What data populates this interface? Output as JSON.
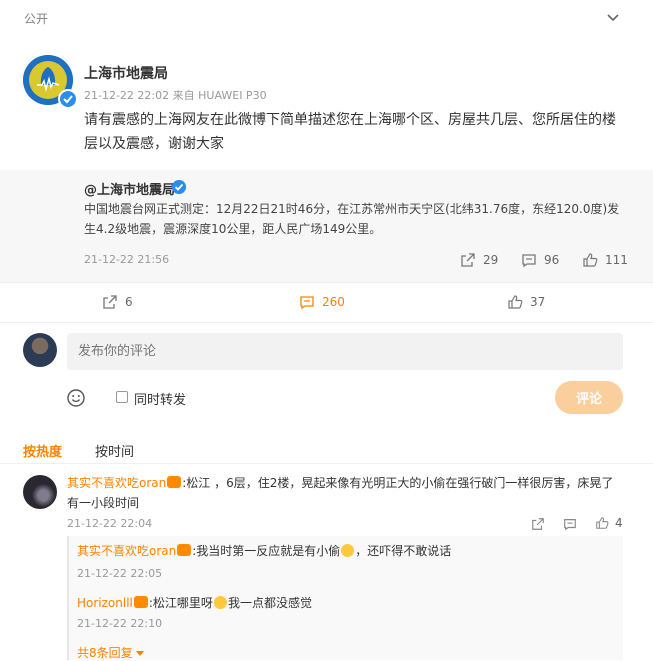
{
  "header": {
    "visibility": "公开",
    "collapse_icon": "chevron-down-icon"
  },
  "post": {
    "author": "上海市地震局",
    "meta": "21-12-22 22:02  来自 HUAWEI P30",
    "text": "请有震感的上海网友在此微博下简单描述您在上海哪个区、房屋共几层、您所居住的楼层以及震感，谢谢大家"
  },
  "repost": {
    "author": "@上海市地震局",
    "text": "中国地震台网正式测定：12月22日21时46分，在江苏常州市天宁区(北纬31.76度，东经120.0度)发生4.2级地震，震源深度10公里，距人民广场149公里。",
    "time": "21-12-22 21:56",
    "forwards": "29",
    "comments": "96",
    "likes": "111"
  },
  "actions": {
    "forwards": "6",
    "comments": "260",
    "likes": "37"
  },
  "composer": {
    "placeholder": "发布你的评论",
    "repost_label": "同时转发",
    "submit_label": "评论"
  },
  "sort_tabs": {
    "hot": "按热度",
    "time": "按时间"
  },
  "comment": {
    "author": "其实不喜欢吃oran",
    "text": ":松江 ，6层，住2楼，晃起来像有光明正大的小偷在强行破门一样很厉害，床晃了有一小段时间",
    "time": "21-12-22 22:04",
    "likes": "4",
    "replies": [
      {
        "author": "其实不喜欢吃oran",
        "text_a": ":我当时第一反应就是有小偷",
        "text_b": "，还吓得不敢说话",
        "time": "21-12-22 22:05"
      },
      {
        "author": "Horizonlll",
        "text_a": ":松江哪里呀",
        "text_b": "我一点都没感觉",
        "time": "21-12-22 22:10"
      }
    ],
    "more_replies": "共8条回复"
  },
  "colors": {
    "accent": "#ff8200",
    "verified": "#2a8ef0",
    "submit_disabled": "#fbcf9d"
  }
}
